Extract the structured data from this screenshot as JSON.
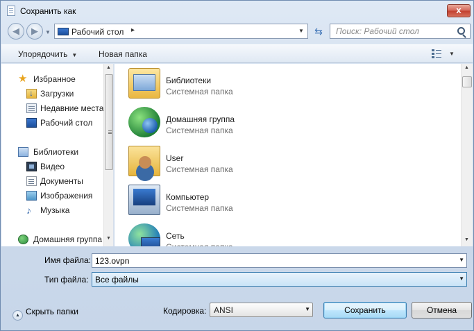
{
  "window": {
    "title": "Сохранить как",
    "close_label": "x"
  },
  "address_bar": {
    "location": "Рабочий стол",
    "separator": "▸",
    "search_placeholder": "Поиск: Рабочий стол"
  },
  "toolbar": {
    "organize_label": "Упорядочить",
    "new_folder_label": "Новая папка"
  },
  "navigation": {
    "favorites": {
      "label": "Избранное",
      "items": [
        "Загрузки",
        "Недавние места",
        "Рабочий стол"
      ]
    },
    "libraries": {
      "label": "Библиотеки",
      "items": [
        "Видео",
        "Документы",
        "Изображения",
        "Музыка"
      ]
    },
    "homegroup": {
      "label": "Домашняя группа"
    }
  },
  "file_list": {
    "items": [
      {
        "name": "Библиотеки",
        "type": "Системная папка",
        "icon": "libraries-icon"
      },
      {
        "name": "Домашняя группа",
        "type": "Системная папка",
        "icon": "homegroup-icon"
      },
      {
        "name": "User",
        "type": "Системная папка",
        "icon": "user-folder-icon"
      },
      {
        "name": "Компьютер",
        "type": "Системная папка",
        "icon": "computer-icon"
      },
      {
        "name": "Сеть",
        "type": "Системная папка",
        "icon": "network-icon"
      }
    ]
  },
  "save_form": {
    "filename_label": "Имя файла:",
    "filename_value": "123.ovpn",
    "filetype_label": "Тип файла:",
    "filetype_value": "Все файлы",
    "hide_folders_label": "Скрыть папки",
    "encoding_label": "Кодировка:",
    "encoding_value": "ANSI",
    "save_label": "Сохранить",
    "cancel_label": "Отмена"
  }
}
